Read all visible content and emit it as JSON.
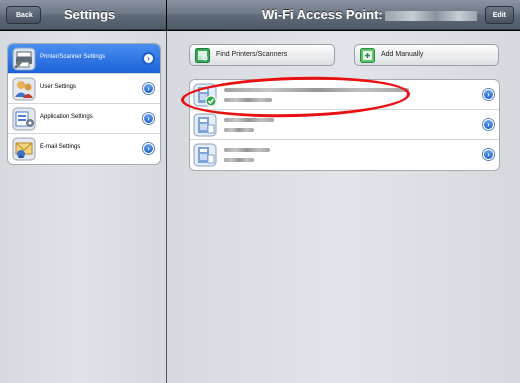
{
  "left_nav": {
    "title": "Settings",
    "back_label": "Back"
  },
  "right_nav": {
    "title": "Wi-Fi Access Point:",
    "edit_label": "Edit"
  },
  "menu": {
    "items": [
      {
        "label": "Printer/Scanner Settings",
        "icon": "printer-scanner-icon",
        "selected": true
      },
      {
        "label": "User Settings",
        "icon": "user-icon",
        "selected": false
      },
      {
        "label": "Application Settings",
        "icon": "application-icon",
        "selected": false
      },
      {
        "label": "E-mail Settings",
        "icon": "email-icon",
        "selected": false
      }
    ]
  },
  "actions": {
    "find_label": "Find Printers/Scanners",
    "add_label": "Add Manually"
  },
  "devices": {
    "count_shown": 3,
    "first_registered_check": true
  },
  "colors": {
    "selected_row": "#1a62d8",
    "annotation": "#e81010",
    "disclosure": "#1c5fd0"
  }
}
